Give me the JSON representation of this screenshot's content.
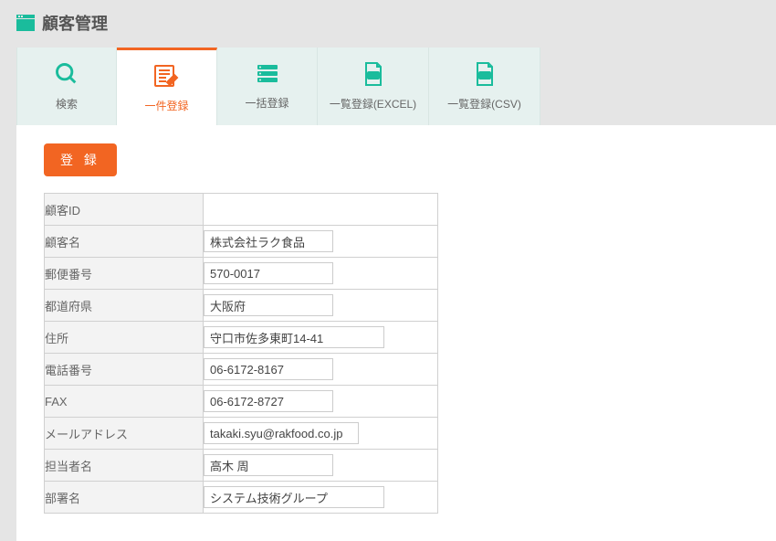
{
  "header": {
    "title": "顧客管理"
  },
  "tabs": {
    "search": "検索",
    "single": "一件登録",
    "bulk": "一括登録",
    "excel": "一覧登録(EXCEL)",
    "csv": "一覧登録(CSV)"
  },
  "button": {
    "register": "登 録"
  },
  "form": {
    "labels": {
      "customer_id": "顧客ID",
      "customer_name": "顧客名",
      "postal_code": "郵便番号",
      "prefecture": "都道府県",
      "address": "住所",
      "phone": "電話番号",
      "fax": "FAX",
      "email": "メールアドレス",
      "contact_name": "担当者名",
      "department": "部署名"
    },
    "values": {
      "customer_id": "",
      "customer_name": "株式会社ラク食品",
      "postal_code": "570-0017",
      "prefecture": "大阪府",
      "address": "守口市佐多東町14-41",
      "phone": "06-6172-8167",
      "fax": "06-6172-8727",
      "email": "takaki.syu@rakfood.co.jp",
      "contact_name": "高木 周",
      "department": "システム技術グループ"
    }
  }
}
